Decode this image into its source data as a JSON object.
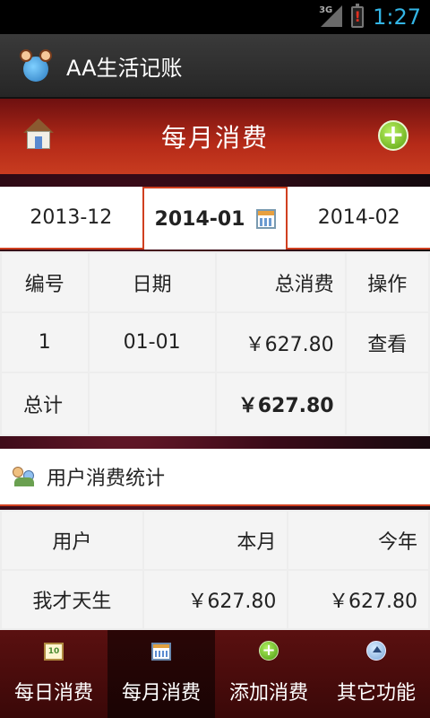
{
  "status_bar": {
    "network": "3G",
    "time": "1:27"
  },
  "app": {
    "title": "AA生活记账"
  },
  "header": {
    "title": "每月消费"
  },
  "month_tabs": [
    {
      "label": "2013-12",
      "active": false
    },
    {
      "label": "2014-01",
      "active": true
    },
    {
      "label": "2014-02",
      "active": false
    }
  ],
  "monthly_table": {
    "headers": [
      "编号",
      "日期",
      "总消费",
      "操作"
    ],
    "rows": [
      {
        "id": "1",
        "date": "01-01",
        "total": "￥627.80",
        "action": "查看"
      }
    ],
    "totals": {
      "label": "总计",
      "total": "￥627.80"
    }
  },
  "user_stats": {
    "title": "用户消费统计",
    "headers": [
      "用户",
      "本月",
      "今年"
    ],
    "rows": [
      {
        "user": "我才天生",
        "month": "￥627.80",
        "year": "￥627.80"
      }
    ]
  },
  "bottom_nav": [
    {
      "label": "每日消费",
      "icon": "daily-calendar-icon",
      "active": false
    },
    {
      "label": "每月消费",
      "icon": "monthly-calendar-icon",
      "active": true
    },
    {
      "label": "添加消费",
      "icon": "add-icon",
      "active": false
    },
    {
      "label": "其它功能",
      "icon": "eject-icon",
      "active": false
    }
  ],
  "colors": {
    "accent": "#d04020",
    "header_dark": "#6e1010",
    "clock": "#33b5e5"
  }
}
